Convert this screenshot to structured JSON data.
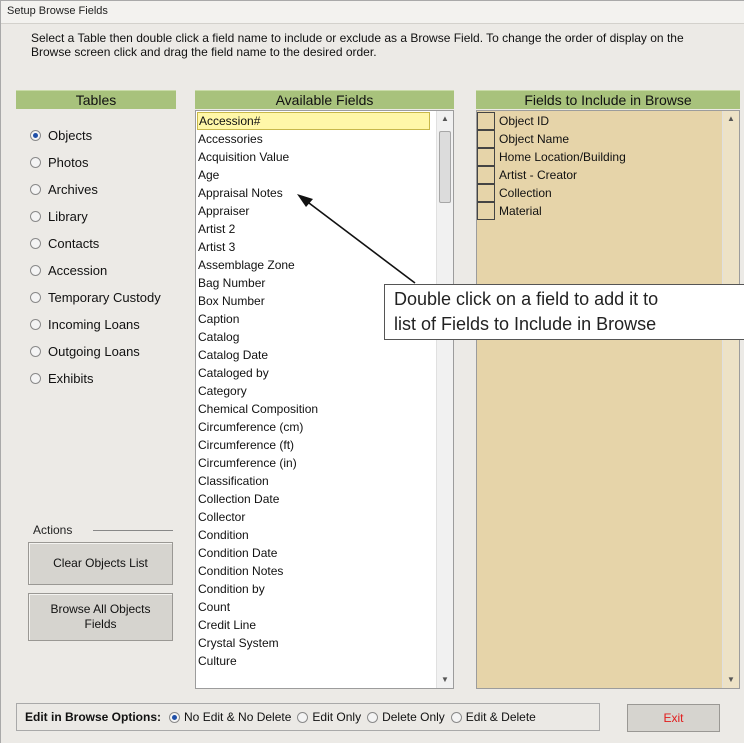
{
  "window": {
    "title": "Setup Browse Fields"
  },
  "instructions": "Select a Table then double click a field name to include or exclude as a Browse Field.  To change the order of display on the Browse screen click and drag the field name to the desired order.",
  "tables": {
    "header": "Tables",
    "items": [
      {
        "label": "Objects",
        "selected": true
      },
      {
        "label": "Photos",
        "selected": false
      },
      {
        "label": "Archives",
        "selected": false
      },
      {
        "label": "Library",
        "selected": false
      },
      {
        "label": "Contacts",
        "selected": false
      },
      {
        "label": "Accession",
        "selected": false
      },
      {
        "label": "Temporary Custody",
        "selected": false
      },
      {
        "label": "Incoming Loans",
        "selected": false
      },
      {
        "label": "Outgoing Loans",
        "selected": false
      },
      {
        "label": "Exhibits",
        "selected": false
      }
    ]
  },
  "actions": {
    "label": "Actions",
    "clear_button": "Clear Objects List",
    "browse_all_button": "Browse All Objects Fields"
  },
  "available": {
    "header": "Available Fields",
    "selected_index": 0,
    "items": [
      "Accession#",
      "Accessories",
      "Acquisition Value",
      "Age",
      "Appraisal Notes",
      "Appraiser",
      "Artist 2",
      "Artist 3",
      "Assemblage Zone",
      "Bag Number",
      "Box Number",
      "Caption",
      "Catalog",
      "Catalog Date",
      "Cataloged by",
      "Category",
      "Chemical Composition",
      "Circumference (cm)",
      "Circumference (ft)",
      "Circumference (in)",
      "Classification",
      "Collection Date",
      "Collector",
      "Condition",
      "Condition Date",
      "Condition Notes",
      "Condition by",
      "Count",
      "Credit Line",
      "Crystal System",
      "Culture"
    ]
  },
  "browse": {
    "header": "Fields to Include in Browse",
    "items": [
      "Object ID",
      "Object Name",
      "Home Location/Building",
      "Artist - Creator",
      "Collection",
      "Material"
    ]
  },
  "callout": {
    "line1": "Double click on a field to add it to",
    "line2": "list of Fields to Include in Browse"
  },
  "bottom": {
    "label": "Edit in Browse Options:",
    "options": [
      {
        "label": "No Edit & No Delete",
        "selected": true
      },
      {
        "label": "Edit Only",
        "selected": false
      },
      {
        "label": "Delete Only",
        "selected": false
      },
      {
        "label": "Edit & Delete",
        "selected": false
      }
    ],
    "exit": "Exit"
  },
  "colors": {
    "header_green": "#a8c27c",
    "browse_tan": "#e6d4a9",
    "selected_yellow": "#fff7a8",
    "exit_red": "#e21b1b"
  }
}
